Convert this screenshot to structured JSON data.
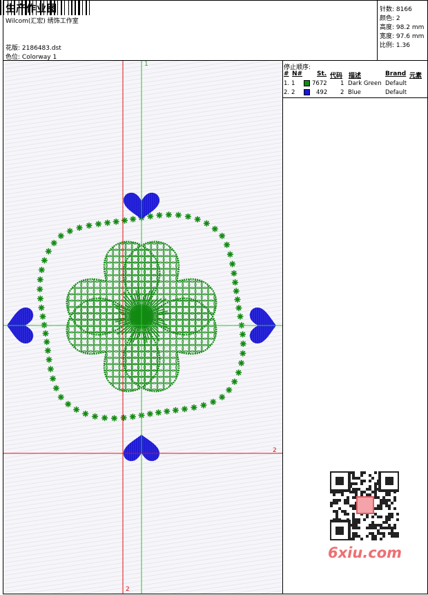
{
  "header": {
    "title": "生产作业图",
    "company": "Wilcom(汇宏) 绣饰工作室",
    "design_label": "花版:",
    "design_file": "2186483.dst",
    "colorway_label": "色位:",
    "colorway_name": "Colorway 1"
  },
  "stats": [
    {
      "label": "针数:",
      "value": "8166"
    },
    {
      "label": "颜色:",
      "value": "2"
    },
    {
      "label": "高度:",
      "value": "98.2 mm"
    },
    {
      "label": "宽度:",
      "value": "97.6 mm"
    },
    {
      "label": "比例:",
      "value": "1.36"
    }
  ],
  "stop_sequence": {
    "title": "停止顺序:",
    "headers": [
      "#",
      "N#",
      "St.",
      "代码",
      "描述",
      "Brand",
      "元素"
    ],
    "rows": [
      {
        "index": "1.",
        "needle": "1",
        "stitches": "7672",
        "code": "1",
        "description": "Dark Green",
        "brand": "Default",
        "color": "#128a12"
      },
      {
        "index": "2.",
        "needle": "2",
        "stitches": "492",
        "code": "2",
        "description": "Blue",
        "brand": "Default",
        "color": "#1a16d6"
      }
    ]
  },
  "canvas": {
    "guide_labels": {
      "green_top": "1",
      "red_right": "2",
      "red_bottom": "2"
    },
    "thread_colors": {
      "green": "#128a12",
      "blue": "#1a16d6",
      "guide_green": "#22cc22",
      "guide_red": "#dd1111"
    }
  },
  "watermark": {
    "text": "6xiu.com",
    "stamp": "六秀图库",
    "color": "#ee6f72"
  }
}
